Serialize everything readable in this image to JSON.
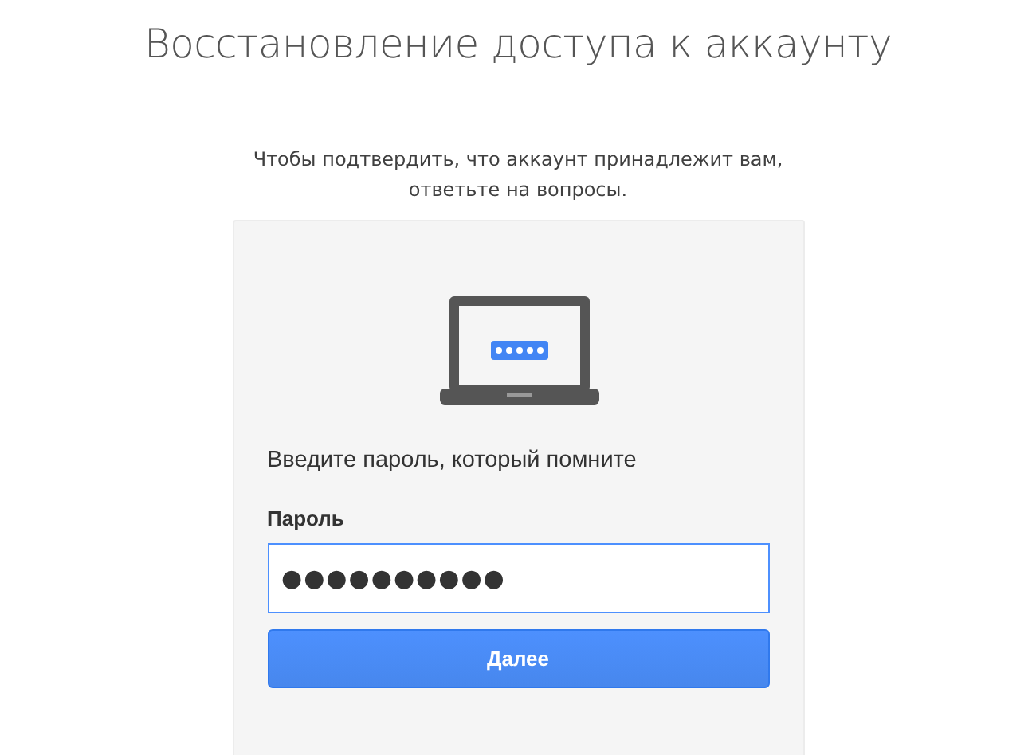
{
  "title": "Восстановление доступа к аккаунту",
  "subtitle": [
    "Чтобы подтвердить, что аккаунт принадлежит вам,",
    "ответьте на вопросы."
  ],
  "card": {
    "prompt": "Введите пароль, который помните",
    "field": {
      "label": "Пароль",
      "value": "●●●●●●●●●●",
      "focused": true
    },
    "button": "Далее"
  }
}
